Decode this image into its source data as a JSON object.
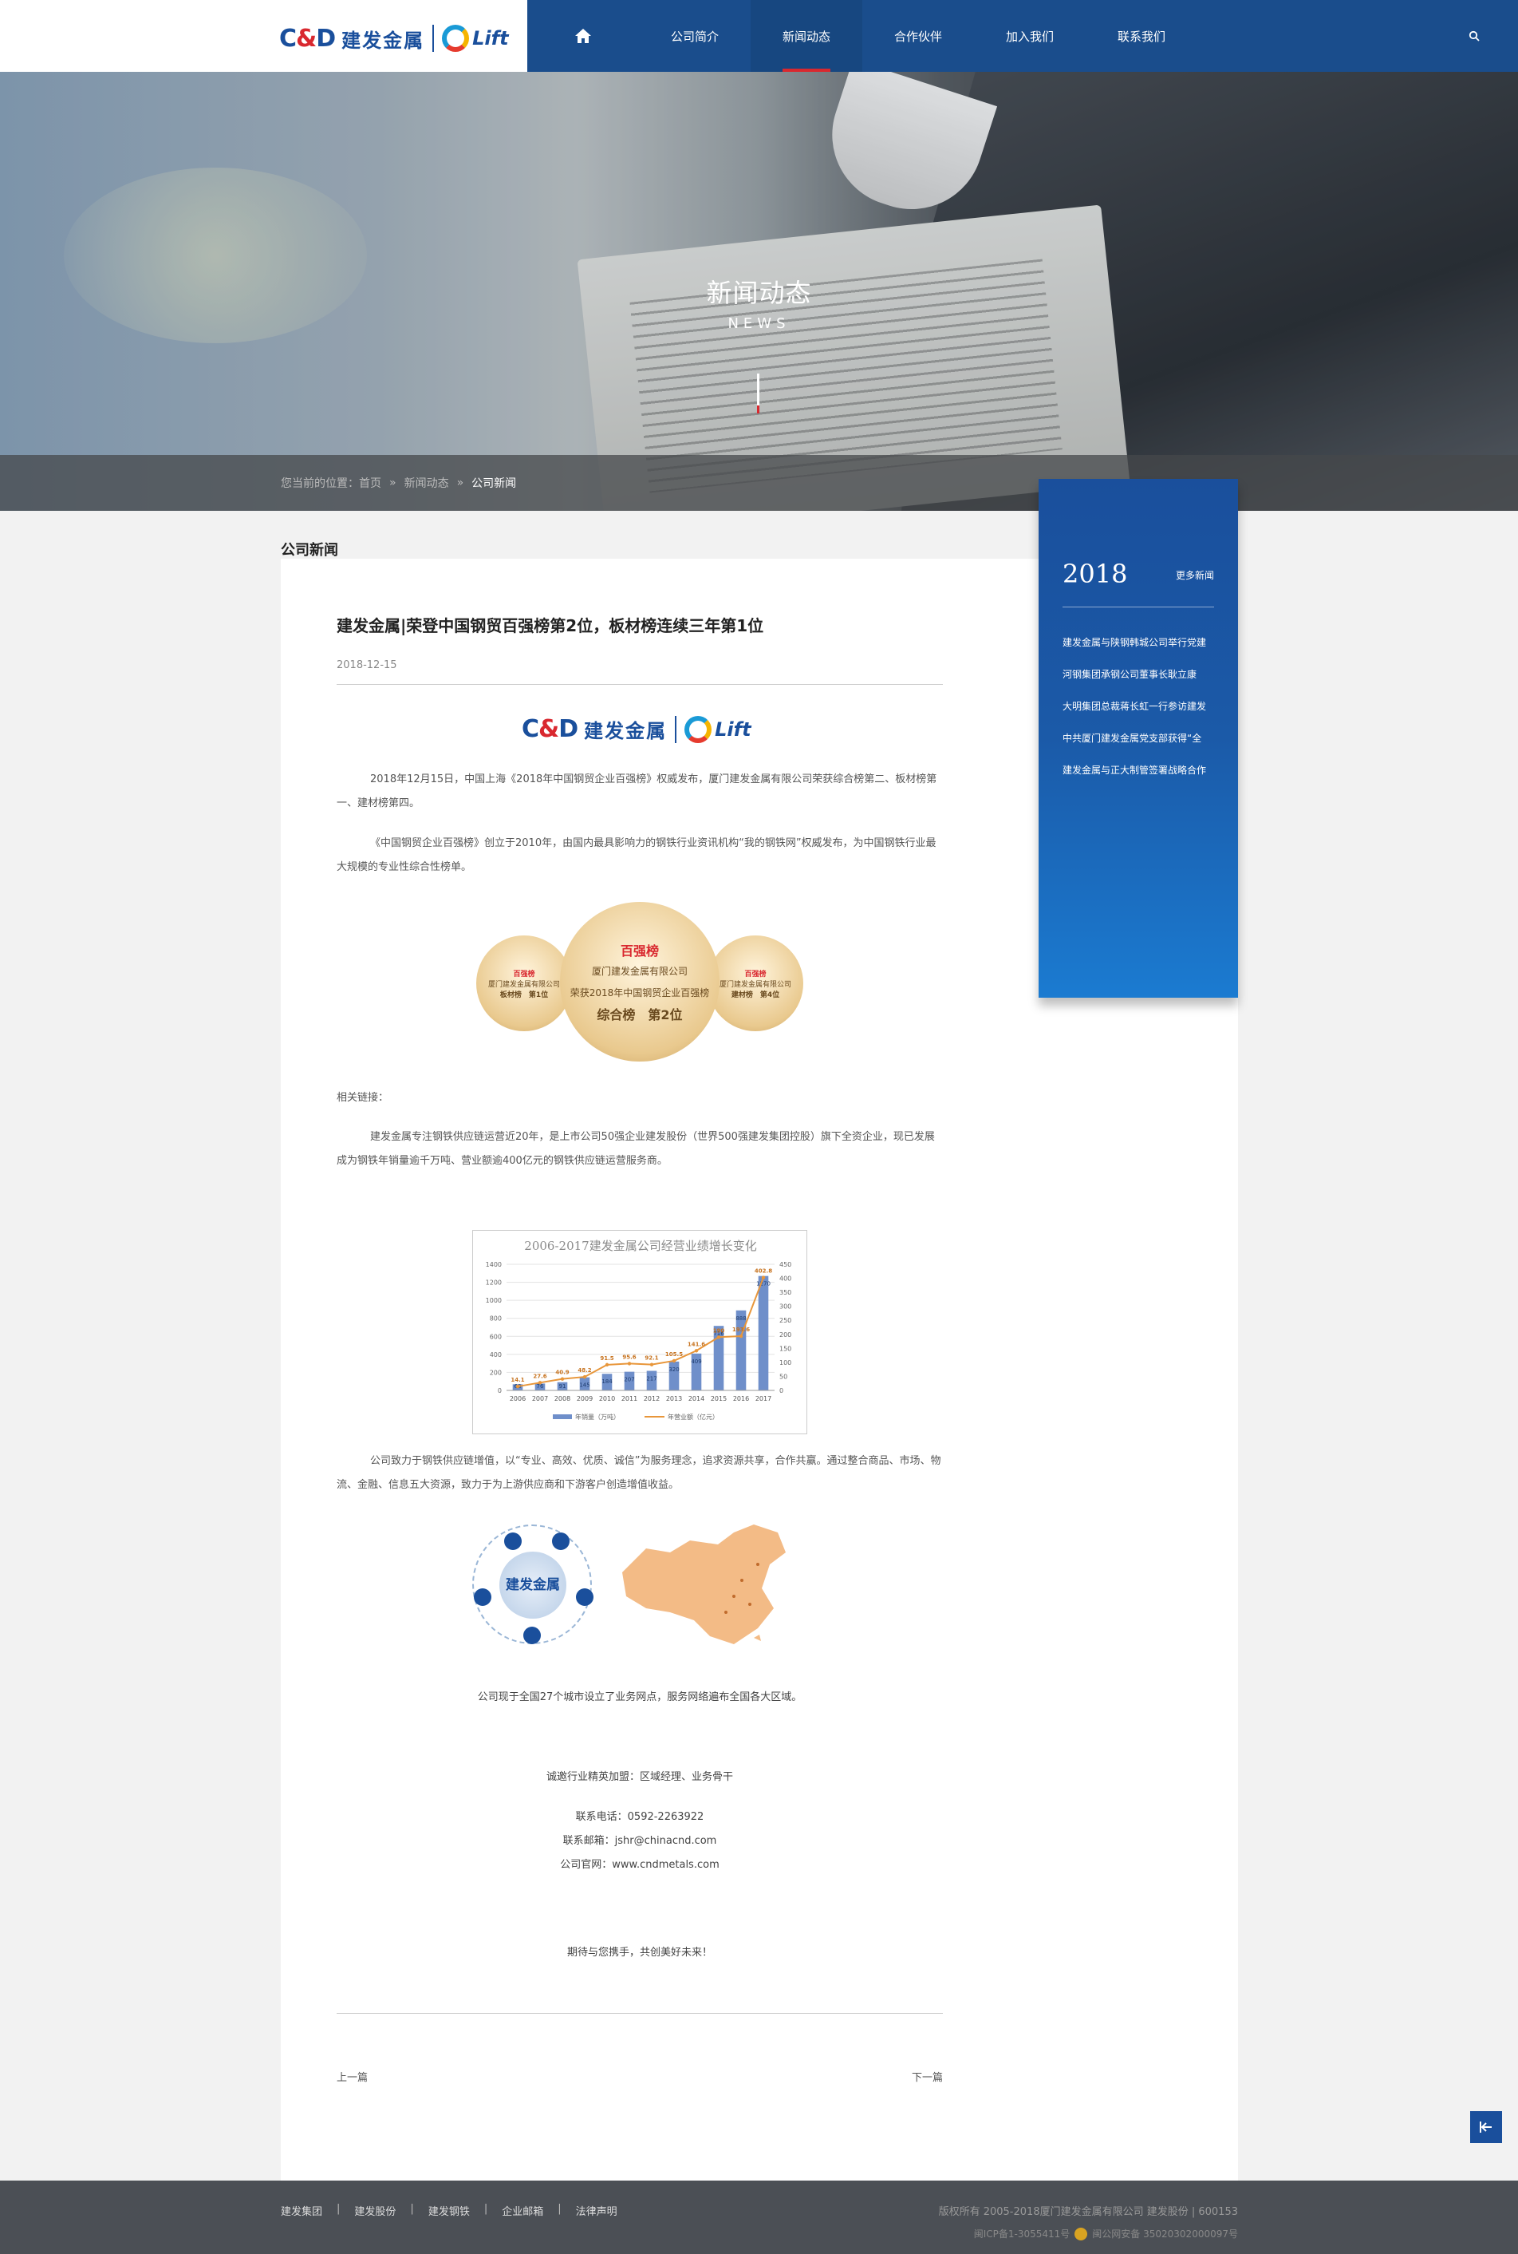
{
  "header": {
    "logo_cd": "C",
    "logo_amp": "&",
    "logo_d": "D",
    "logo_cn": "建发金属",
    "logo_lift": "Lift",
    "nav": [
      "公司简介",
      "新闻动态",
      "合作伙伴",
      "加入我们",
      "联系我们"
    ],
    "active_index": 1
  },
  "banner": {
    "title": "新闻动态",
    "subtitle": "NEWS",
    "breadcrumb": [
      "您当前的位置：首页",
      "»",
      "新闻动态",
      "»",
      "公司新闻"
    ]
  },
  "section_label": "公司新闻",
  "article": {
    "title": "建发金属|荣登中国钢贸百强榜第2位，板材榜连续三年第1位",
    "date": "2018-12-15",
    "p1": "2018年12月15日，中国上海《2018年中国钢贸企业百强榜》权威发布，厦门建发金属有限公司荣获综合榜第二、板材榜第一、建材榜第四。",
    "p2": "《中国钢贸企业百强榜》创立于2010年，由国内最具影响力的钢铁行业资讯机构“我的钢铁网”权威发布，为中国钢铁行业最大规模的专业性综合性榜单。",
    "seals": {
      "brand": "百强榜",
      "company": "厦门建发金属有限公司",
      "award": "荣获2018年中国钢贸企业百强榜",
      "main_rank": "综合榜　第2位",
      "left_rank": "板材榜　第1位",
      "right_rank": "建材榜　第4位"
    },
    "related_label": "相关链接：",
    "p3": "建发金属专注钢铁供应链运营近20年，是上市公司50强企业建发股份（世界500强建发集团控股）旗下全资企业，现已发展成为钢铁年销量逾千万吨、营业额逾400亿元的钢铁供应链运营服务商。",
    "p4": "公司致力于钢铁供应链增值，以“专业、高效、优质、诚信”为服务理念，追求资源共享，合作共赢。通过整合商品、市场、物流、金融、信息五大资源，致力于为上游供应商和下游客户创造增值收益。",
    "diagram_core": "建发金属",
    "network_note": "公司现于全国27个城市设立了业务网点，服务网络遍布全国各大区域。",
    "recruit": "诚邀行业精英加盟：区域经理、业务骨干",
    "phone": "联系电话：0592-2263922",
    "email": "联系邮箱：jshr@chinacnd.com",
    "site": "公司官网：www.cndmetals.com",
    "closing": "期待与您携手，共创美好未来！",
    "prev": "上一篇",
    "next": "下一篇"
  },
  "chart_data": {
    "type": "bar",
    "title": "2006-2017建发金属公司经营业绩增长变化",
    "categories": [
      "2006",
      "2007",
      "2008",
      "2009",
      "2010",
      "2011",
      "2012",
      "2013",
      "2014",
      "2015",
      "2016",
      "2017"
    ],
    "series": [
      {
        "name": "年销量（万吨）",
        "type": "bar",
        "axis": "left",
        "values": [
          68,
          76,
          91,
          145,
          184,
          207,
          217,
          320,
          409,
          716,
          888,
          1270
        ]
      },
      {
        "name": "年营业额（亿元）",
        "type": "line",
        "axis": "right",
        "values": [
          14.1,
          27.6,
          40.9,
          48.2,
          91.5,
          95.6,
          92.1,
          105.5,
          141.6,
          190,
          193.6,
          402.8
        ]
      }
    ],
    "ylim_left": [
      0,
      1400
    ],
    "yticks_left": [
      0,
      200,
      400,
      600,
      800,
      1000,
      1200,
      1400
    ],
    "ylim_right": [
      0,
      450
    ],
    "yticks_right": [
      0,
      50,
      100,
      150,
      200,
      250,
      300,
      350,
      400,
      450
    ],
    "legend_position": "bottom",
    "colors": {
      "bar": "#6f8fca",
      "line": "#e8963a",
      "title": "#8a8a8a"
    }
  },
  "sidebar": {
    "year": "2018",
    "more": "更多新闻",
    "items": [
      "建发金属与陕钢韩城公司举行党建",
      "河钢集团承钢公司董事长耿立康",
      "大明集团总裁蒋长虹一行参访建发",
      "中共厦门建发金属党支部获得“全",
      "建发金属与正大制管签署战略合作"
    ]
  },
  "footer": {
    "links": [
      "建发集团",
      "建发股份",
      "建发钢铁",
      "企业邮箱",
      "法律声明"
    ],
    "copyright": "版权所有 2005-2018厦门建发金属有限公司 建发股份 | 600153",
    "icp": "闽ICP备1-3055411号",
    "police": "闽公网安备 35020302000097号"
  },
  "colors": {
    "nav": "#1a4d8c",
    "accent": "#d9282f",
    "footer": "#4b4f55"
  }
}
